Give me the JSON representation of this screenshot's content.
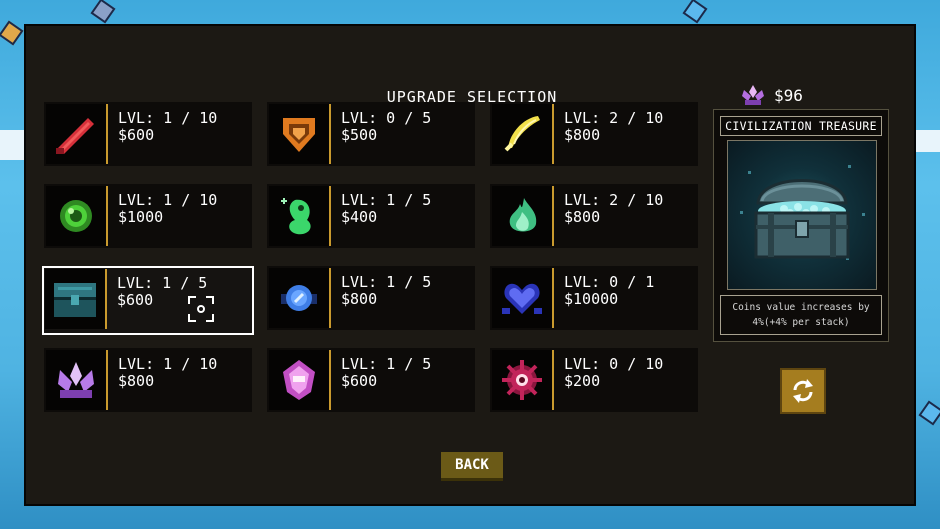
{
  "title": "UPGRADE SELECTION",
  "currency": {
    "icon": "crystal-icon",
    "amount": "$96"
  },
  "upgrades": [
    {
      "icon": "red-blade-icon",
      "level": "LVL: 1 / 10",
      "price": "$600",
      "color": "#d6303a"
    },
    {
      "icon": "orange-shield-icon",
      "level": "LVL: 0 / 5",
      "price": "$500",
      "color": "#e07a1f"
    },
    {
      "icon": "yellow-feather-icon",
      "level": "LVL: 2 / 10",
      "price": "$800",
      "color": "#f2e04a"
    },
    {
      "icon": "green-orb-icon",
      "level": "LVL: 1 / 10",
      "price": "$1000",
      "color": "#4ed13a"
    },
    {
      "icon": "green-spirit-icon",
      "level": "LVL: 1 / 5",
      "price": "$400",
      "color": "#3bd66b"
    },
    {
      "icon": "mint-flame-icon",
      "level": "LVL: 2 / 10",
      "price": "$800",
      "color": "#6de4a8"
    },
    {
      "icon": "treasure-chest-icon",
      "level": "LVL: 1 / 5",
      "price": "$600",
      "color": "#2f7680"
    },
    {
      "icon": "blue-ring-icon",
      "level": "LVL: 1 / 5",
      "price": "$800",
      "color": "#3f7ee6"
    },
    {
      "icon": "blue-heart-icon",
      "level": "LVL: 0 / 1",
      "price": "$10000",
      "color": "#3a46e0"
    },
    {
      "icon": "purple-crystal-icon",
      "level": "LVL: 1 / 10",
      "price": "$800",
      "color": "#b77be8"
    },
    {
      "icon": "pink-gem-icon",
      "level": "LVL: 1 / 5",
      "price": "$600",
      "color": "#e278e0"
    },
    {
      "icon": "crimson-eye-icon",
      "level": "LVL: 0 / 10",
      "price": "$200",
      "color": "#c2245a"
    }
  ],
  "selected_index": 6,
  "detail": {
    "title": "CIVILIZATION TREASURE",
    "description_line1": "Coins value increases by",
    "description_line2": "4%(+4% per stack)"
  },
  "reroll_icon": "refresh-icon",
  "back_label": "BACK"
}
